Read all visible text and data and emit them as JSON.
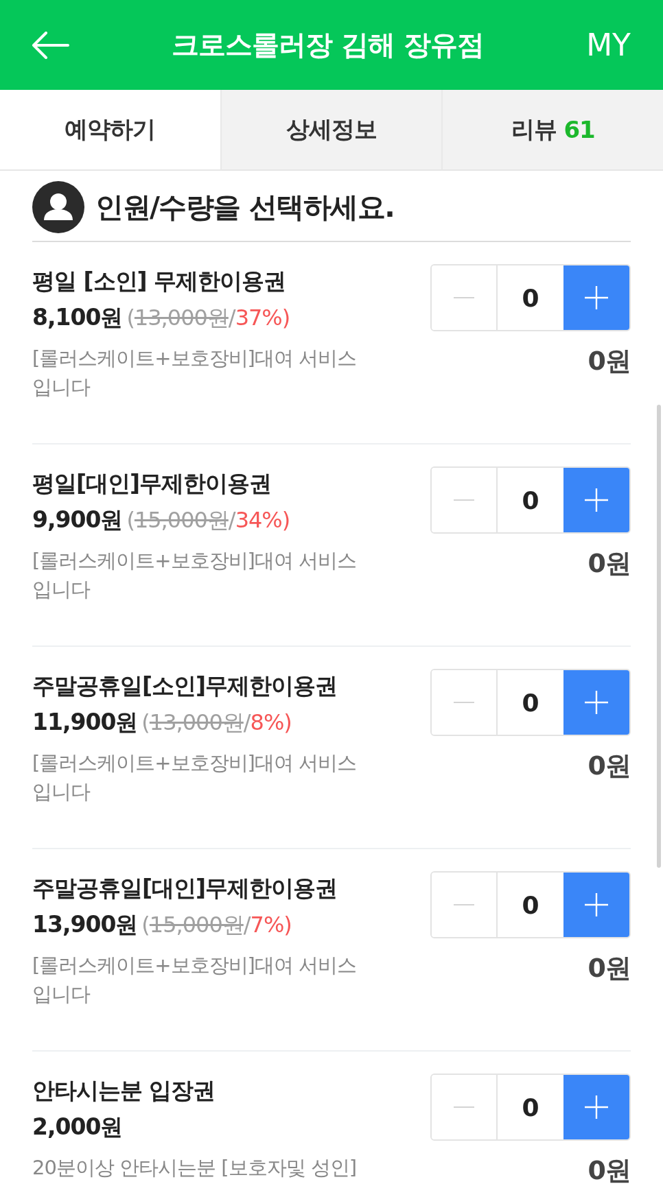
{
  "header": {
    "title": "크로스롤러장 김해 장유점",
    "my": "MY"
  },
  "tabs": [
    {
      "label": "예약하기",
      "selected": true
    },
    {
      "label": "상세정보",
      "selected": false
    },
    {
      "label": "리뷰",
      "count": "61",
      "selected": false
    }
  ],
  "section": {
    "heading": "인원/수량을 선택하세요."
  },
  "items": [
    {
      "title": "평일 [소인] 무제한이용권",
      "price": "8,100원",
      "was": {
        "open": "(",
        "price": "13,000원",
        "sep": "/",
        "discount": "37%)"
      },
      "description": "[롤러스케이트+보호장비]대여 서비스 입니다",
      "quantity": "0",
      "minus_disabled": true,
      "total": "0원"
    },
    {
      "title": "평일[대인]무제한이용권",
      "price": "9,900원",
      "was": {
        "open": "(",
        "price": "15,000원",
        "sep": "/",
        "discount": "34%)"
      },
      "description": "[롤러스케이트+보호장비]대여 서비스 입니다",
      "quantity": "0",
      "minus_disabled": true,
      "total": "0원"
    },
    {
      "title": "주말공휴일[소인]무제한이용권",
      "price": "11,900원",
      "was": {
        "open": "(",
        "price": "13,000원",
        "sep": "/",
        "discount": "8%)"
      },
      "description": "[롤러스케이트+보호장비]대여 서비스 입니다",
      "quantity": "0",
      "minus_disabled": true,
      "total": "0원"
    },
    {
      "title": "주말공휴일[대인]무제한이용권",
      "price": "13,900원",
      "was": {
        "open": "(",
        "price": "15,000원",
        "sep": "/",
        "discount": "7%)"
      },
      "description": "[롤러스케이트+보호장비]대여 서비스 입니다",
      "quantity": "0",
      "minus_disabled": true,
      "total": "0원"
    },
    {
      "title": "안타시는분 입장권",
      "price": "2,000원",
      "description": "20분이상 안타시는분 [보호자및 성인]",
      "quantity": "0",
      "minus_disabled": true,
      "total": "0원"
    }
  ]
}
